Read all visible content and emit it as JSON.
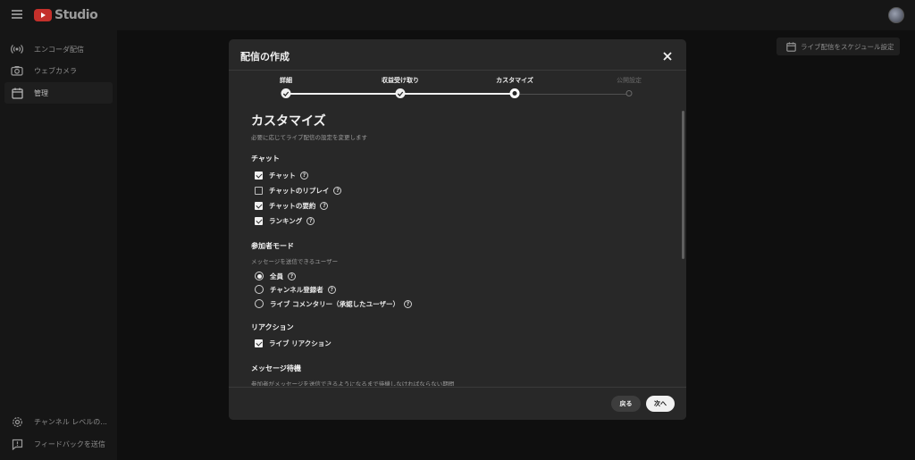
{
  "app": {
    "logo_text": "Studio"
  },
  "sidebar": {
    "items": [
      {
        "label": "エンコーダ配信",
        "icon": "broadcast-icon"
      },
      {
        "label": "ウェブカメラ",
        "icon": "camera-icon"
      },
      {
        "label": "管理",
        "icon": "calendar-icon",
        "active": true
      }
    ],
    "bottom_items": [
      {
        "label": "チャンネル レベルの...",
        "icon": "gear-icon"
      },
      {
        "label": "フィードバックを送信",
        "icon": "feedback-icon"
      }
    ]
  },
  "main": {
    "schedule_button": "ライブ配信をスケジュール設定"
  },
  "dialog": {
    "title": "配信の作成",
    "steps": [
      {
        "label": "詳細",
        "state": "done"
      },
      {
        "label": "収益受け取り",
        "state": "done"
      },
      {
        "label": "カスタマイズ",
        "state": "current"
      },
      {
        "label": "公開設定",
        "state": "todo"
      }
    ],
    "heading": "カスタマイズ",
    "subtitle": "必要に応じてライブ配信の設定を変更します",
    "chat": {
      "title": "チャット",
      "options": [
        {
          "label": "チャット",
          "checked": true
        },
        {
          "label": "チャットのリプレイ",
          "checked": false
        },
        {
          "label": "チャットの要約",
          "checked": true
        },
        {
          "label": "ランキング",
          "checked": true
        }
      ]
    },
    "participant_mode": {
      "title": "参加者モード",
      "description": "メッセージを送信できるユーザー",
      "options": [
        {
          "label": "全員",
          "selected": true
        },
        {
          "label": "チャンネル登録者",
          "selected": false
        },
        {
          "label": "ライブ コメンタリー（承認したユーザー）",
          "selected": false
        }
      ]
    },
    "reactions": {
      "title": "リアクション",
      "options": [
        {
          "label": "ライブ リアクション",
          "checked": true
        }
      ]
    },
    "message_delay": {
      "title": "メッセージ待機",
      "description": "参加者がメッセージを送信できるようになるまで待機しなければならない期間"
    },
    "help_glyph": "?",
    "back_button": "戻る",
    "next_button": "次へ"
  }
}
